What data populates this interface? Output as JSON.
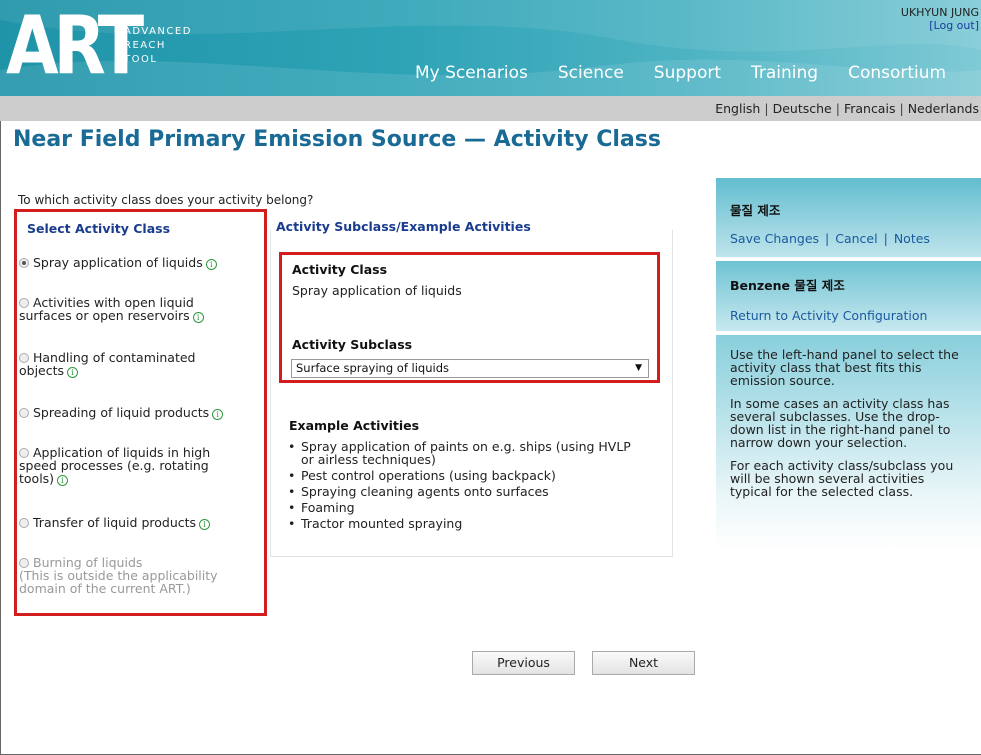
{
  "header": {
    "logo_main": "ART",
    "logo_sub_1": "ADVANCED",
    "logo_sub_2": "REACH",
    "logo_sub_3": "TOOL",
    "user_name": "UKHYUN JUNG",
    "logout": "[Log out]",
    "nav": [
      "My Scenarios",
      "Science",
      "Support",
      "Training",
      "Consortium"
    ]
  },
  "languages": [
    "English",
    "Deutsche",
    "Francais",
    "Nederlands"
  ],
  "page_title": "Near Field Primary Emission Source  —  Activity Class",
  "question": "To which activity class does your activity belong?",
  "left_panel": {
    "heading": "Select Activity Class",
    "options": [
      {
        "lines": [
          "Spray application of liquids"
        ],
        "selected": true,
        "disabled": false,
        "info": true
      },
      {
        "lines": [
          "Activities with open liquid",
          "surfaces or open reservoirs"
        ],
        "selected": false,
        "disabled": false,
        "info": true
      },
      {
        "lines": [
          "Handling of contaminated",
          "objects"
        ],
        "selected": false,
        "disabled": false,
        "info": true
      },
      {
        "lines": [
          "Spreading of liquid products"
        ],
        "selected": false,
        "disabled": false,
        "info": true
      },
      {
        "lines": [
          "Application of liquids in high",
          "speed processes (e.g. rotating",
          "tools)"
        ],
        "selected": false,
        "disabled": false,
        "info": true
      },
      {
        "lines": [
          "Transfer of liquid products"
        ],
        "selected": false,
        "disabled": false,
        "info": true
      },
      {
        "lines": [
          "Burning of liquids",
          "(This is outside the applicability",
          "domain of the current ART.)"
        ],
        "selected": false,
        "disabled": true,
        "info": false
      }
    ]
  },
  "middle": {
    "heading": "Activity Subclass/Example Activities",
    "activity_class_label": "Activity Class",
    "activity_class_value": "Spray application of liquids",
    "activity_subclass_label": "Activity Subclass",
    "subclass_selected": "Surface spraying of liquids",
    "examples_heading": "Example Activities",
    "examples": [
      [
        "Spray application of paints on e.g. ships (using HVLP",
        "or airless techniques)"
      ],
      [
        "Pest control operations (using backpack)"
      ],
      [
        "Spraying cleaning agents onto surfaces"
      ],
      [
        "Foaming"
      ],
      [
        "Tractor mounted spraying"
      ]
    ]
  },
  "buttons": {
    "previous": "Previous",
    "next": "Next"
  },
  "sidebar": {
    "box1_title": "물질 제조",
    "save": "Save Changes",
    "cancel": "Cancel",
    "notes": "Notes",
    "box2_title": "Benzene 물질 제조",
    "return_link": "Return to Activity Configuration",
    "help": [
      "Use the left-hand panel to select the activity class that best fits this emission source.",
      "In some cases an activity class has several subclasses. Use the drop-down list in the right-hand panel to narrow down your selection.",
      "For each activity class/subclass you will be shown several activities typical for the selected class."
    ]
  },
  "colors": {
    "accent": "#1a6a96",
    "highlight_border": "#d11d1d",
    "link": "#1a5a9e"
  }
}
